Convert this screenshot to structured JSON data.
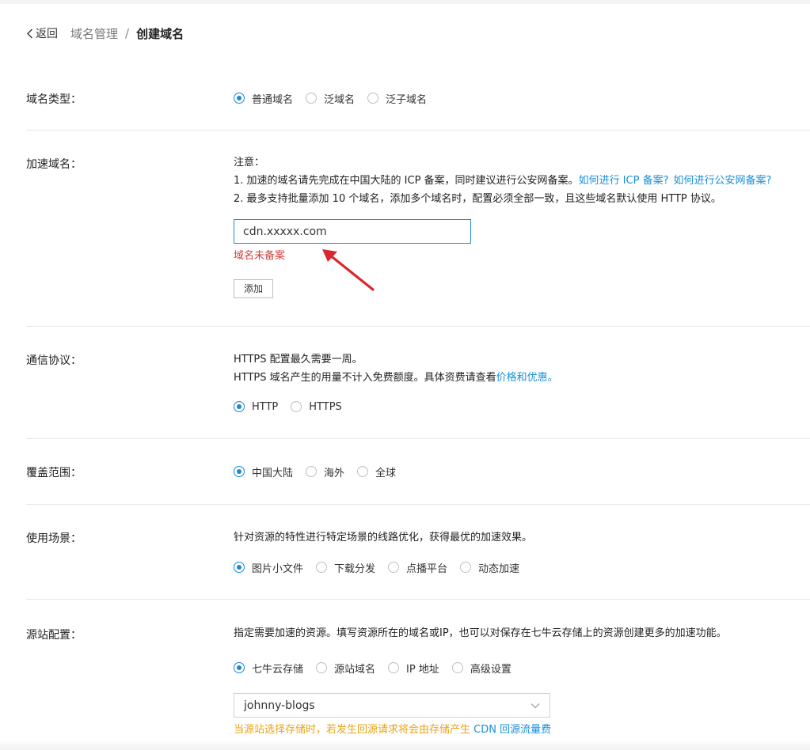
{
  "breadcrumb": {
    "back_label": "返回",
    "parent_label": "域名管理",
    "separator": "/",
    "current_label": "创建域名"
  },
  "domain_type": {
    "label": "域名类型：",
    "options": [
      "普通域名",
      "泛域名",
      "泛子域名"
    ],
    "selected": 0
  },
  "accel_domain": {
    "label": "加速域名：",
    "note_title": "注意：",
    "note1_text": "1. 加速的域名请先完成在中国大陆的 ICP 备案，同时建议进行公安网备案。",
    "note1_link_icp": "如何进行 ICP 备案?",
    "note1_link_police": "如何进行公安网备案?",
    "note2_text": "2. 最多支持批量添加 10 个域名，添加多个域名时，配置必须全部一致，且这些域名默认使用 HTTP 协议。",
    "input_value": "cdn.xxxxx.com",
    "error_text": "域名未备案",
    "add_button": "添加"
  },
  "protocol": {
    "label": "通信协议：",
    "line1": "HTTPS 配置最久需要一周。",
    "line2_text": "HTTPS 域名产生的用量不计入免费额度。具体资费请查看",
    "line2_link": "价格和优惠。",
    "options": [
      "HTTP",
      "HTTPS"
    ],
    "selected": 0
  },
  "coverage": {
    "label": "覆盖范围：",
    "options": [
      "中国大陆",
      "海外",
      "全球"
    ],
    "selected": 0
  },
  "scenario": {
    "label": "使用场景：",
    "description": "针对资源的特性进行特定场景的线路优化，获得最优的加速效果。",
    "options": [
      "图片小文件",
      "下载分发",
      "点播平台",
      "动态加速"
    ],
    "selected": 0
  },
  "origin": {
    "label": "源站配置：",
    "description": "指定需要加速的资源。填写资源所在的域名或IP，也可以对保存在七牛云存储上的资源创建更多的加速功能。",
    "options": [
      "七牛云存储",
      "源站域名",
      "IP 地址",
      "高级设置"
    ],
    "selected": 0,
    "bucket_value": "johnny-blogs",
    "warning_text": "当源站选择存储时，若发生回源请求将会由存储产生 ",
    "warning_link": "CDN 回源流量费"
  },
  "colors": {
    "accent": "#1e88d3",
    "link": "#1a8fd7",
    "error": "#d43f3a",
    "warning": "#e8a317",
    "annotation_arrow": "#d9272e"
  }
}
